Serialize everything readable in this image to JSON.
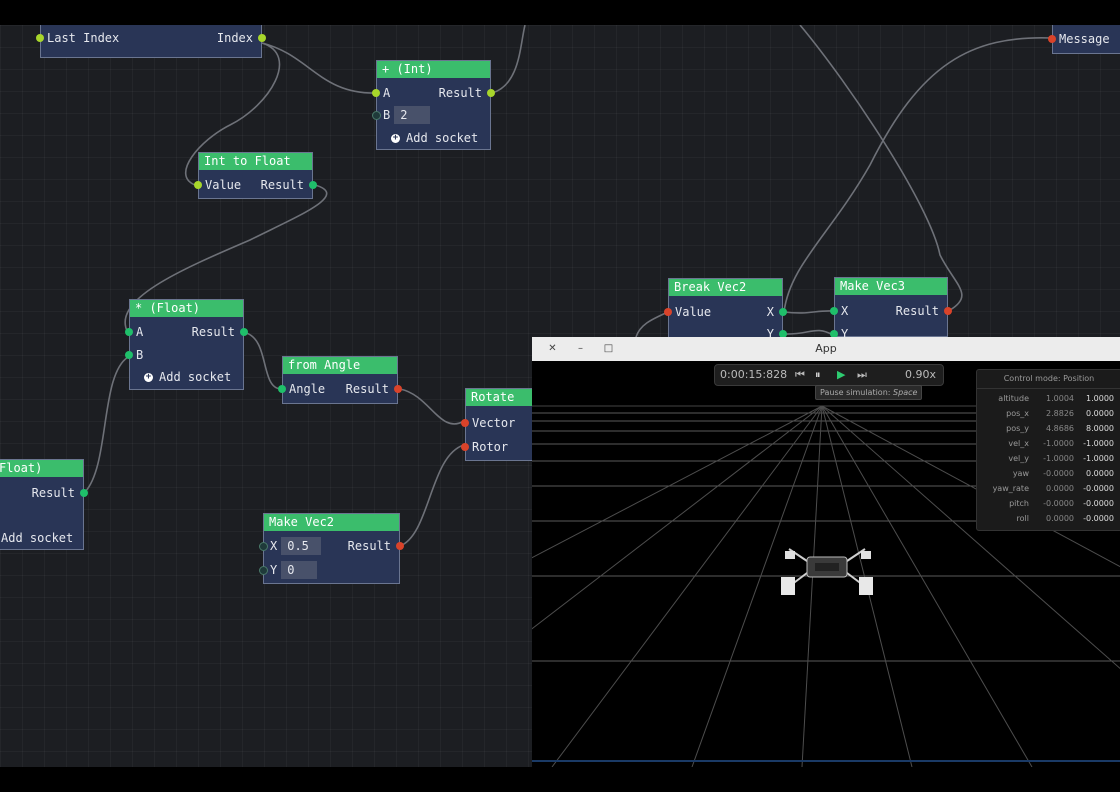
{
  "nodes": {
    "last_index_node": {
      "left_label": "Last Index",
      "right_label": "Index"
    },
    "add_int": {
      "title": "+ (Int)",
      "a": "A",
      "result": "Result",
      "b": "B",
      "b_value": "2",
      "add_socket": "Add socket"
    },
    "int_to_float": {
      "title": "Int to Float",
      "value": "Value",
      "result": "Result"
    },
    "mul_float": {
      "title": "* (Float)",
      "a": "A",
      "result": "Result",
      "b": "B",
      "add_socket": "Add socket"
    },
    "from_angle": {
      "title": "from Angle",
      "angle": "Angle",
      "result": "Result"
    },
    "rotate": {
      "title": "Rotate",
      "vector": "Vector",
      "rotor": "Rotor"
    },
    "float_partial": {
      "title": "Float)",
      "result": "Result",
      "add_socket": "Add socket"
    },
    "make_vec2": {
      "title": "Make Vec2",
      "x": "X",
      "x_value": "0.5",
      "result": "Result",
      "y": "Y",
      "y_value": "0"
    },
    "break_vec2": {
      "title": "Break Vec2",
      "value": "Value",
      "x": "X",
      "y": "Y"
    },
    "make_vec3": {
      "title": "Make Vec3",
      "x": "X",
      "result": "Result",
      "y": "Y"
    },
    "message_node": {
      "label": "Message"
    }
  },
  "app": {
    "title": "App",
    "time": "0:00:15:828",
    "speed": "0.90x",
    "tooltip_label": "Pause simulation",
    "tooltip_key": "Space",
    "panel": {
      "header": "Control mode: Position",
      "rows": [
        {
          "key": "altitude",
          "v1": "1.0004",
          "v2": "1.0000"
        },
        {
          "key": "pos_x",
          "v1": "2.8826",
          "v2": "0.0000"
        },
        {
          "key": "pos_y",
          "v1": "4.8686",
          "v2": "8.0000"
        },
        {
          "key": "vel_x",
          "v1": "-1.0000",
          "v2": "-1.0000"
        },
        {
          "key": "vel_y",
          "v1": "-1.0000",
          "v2": "-1.0000"
        },
        {
          "key": "yaw",
          "v1": "-0.0000",
          "v2": "0.0000"
        },
        {
          "key": "yaw_rate",
          "v1": "0.0000",
          "v2": "-0.0000"
        },
        {
          "key": "pitch",
          "v1": "-0.0000",
          "v2": "-0.0000"
        },
        {
          "key": "roll",
          "v1": "0.0000",
          "v2": "-0.0000"
        }
      ]
    }
  },
  "colors": {
    "header_green": "#3bbd6c",
    "node_body": "#293556",
    "socket_int": "#a8d62b",
    "socket_float": "#1fbf6a",
    "socket_vec": "#d9432a"
  }
}
